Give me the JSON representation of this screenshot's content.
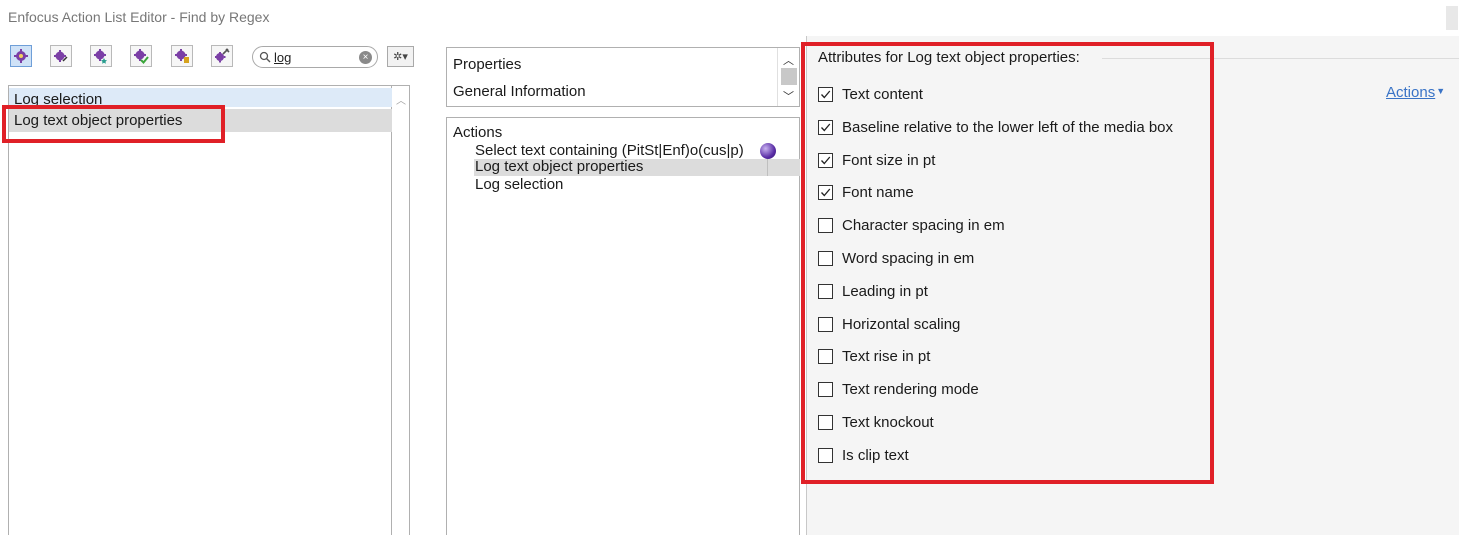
{
  "window": {
    "title": "Enfocus Action List Editor - Find by Regex"
  },
  "toolbar": {
    "buttons": [
      "actions-all-icon",
      "actions-edit-icon",
      "actions-favorites-icon",
      "actions-check-icon",
      "actions-fix-icon",
      "actions-tools-icon"
    ],
    "search": {
      "value": "log",
      "placeholder": ""
    },
    "options_glyph": "✲▾"
  },
  "left_list": {
    "items": [
      {
        "label": "Log selection"
      },
      {
        "label": "Log text object properties"
      }
    ]
  },
  "properties_panel": {
    "rows": [
      {
        "label": "Properties"
      },
      {
        "label": "General Information"
      }
    ]
  },
  "actions_panel": {
    "header": "Actions",
    "items": [
      {
        "label": "Select text containing (PitSt|Enf)o(cus|p)"
      },
      {
        "label": "Log text object properties"
      },
      {
        "label": "Log selection"
      }
    ]
  },
  "attributes": {
    "title": "Attributes for Log text object properties:",
    "actions_link": "Actions",
    "items": [
      {
        "label": "Text content",
        "checked": true
      },
      {
        "label": "Baseline relative to the lower left of the media box",
        "checked": true
      },
      {
        "label": "Font size in pt",
        "checked": true
      },
      {
        "label": "Font name",
        "checked": true
      },
      {
        "label": "Character spacing in em",
        "checked": false
      },
      {
        "label": "Word spacing in em",
        "checked": false
      },
      {
        "label": "Leading in pt",
        "checked": false
      },
      {
        "label": "Horizontal scaling",
        "checked": false
      },
      {
        "label": "Text rise in pt",
        "checked": false
      },
      {
        "label": "Text rendering mode",
        "checked": false
      },
      {
        "label": "Text knockout",
        "checked": false
      },
      {
        "label": "Is clip text",
        "checked": false
      }
    ]
  },
  "colors": {
    "highlight_red": "#e02027",
    "selection_gray": "#dcdcdc",
    "selection_blue": "#ddeaf8",
    "link_blue": "#3973c6",
    "toolbar_icon_purple": "#7b3fa6"
  }
}
